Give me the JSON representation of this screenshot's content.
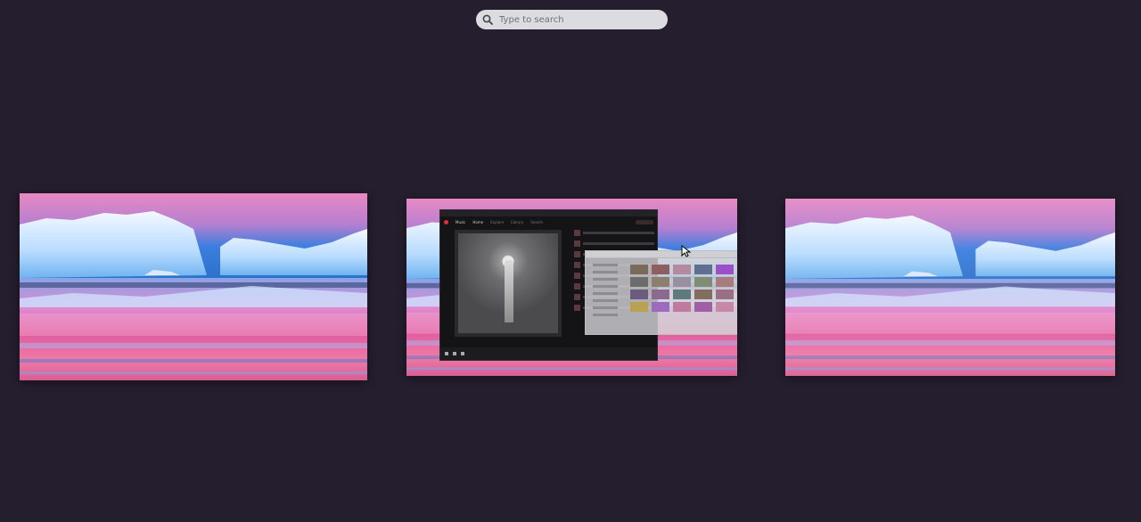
{
  "search": {
    "placeholder": "Type to search",
    "icon": "search-icon"
  },
  "workspaces": [
    {
      "label": "workspace-1"
    },
    {
      "label": "workspace-2"
    },
    {
      "label": "workspace-3"
    }
  ],
  "music_window": {
    "app": "Music",
    "nav": [
      "Home",
      "Explore",
      "Library",
      "Search"
    ]
  },
  "colors": {
    "background": "#251e2e",
    "search_bg": "#dcdce0",
    "accent_red": "#e5303a"
  }
}
